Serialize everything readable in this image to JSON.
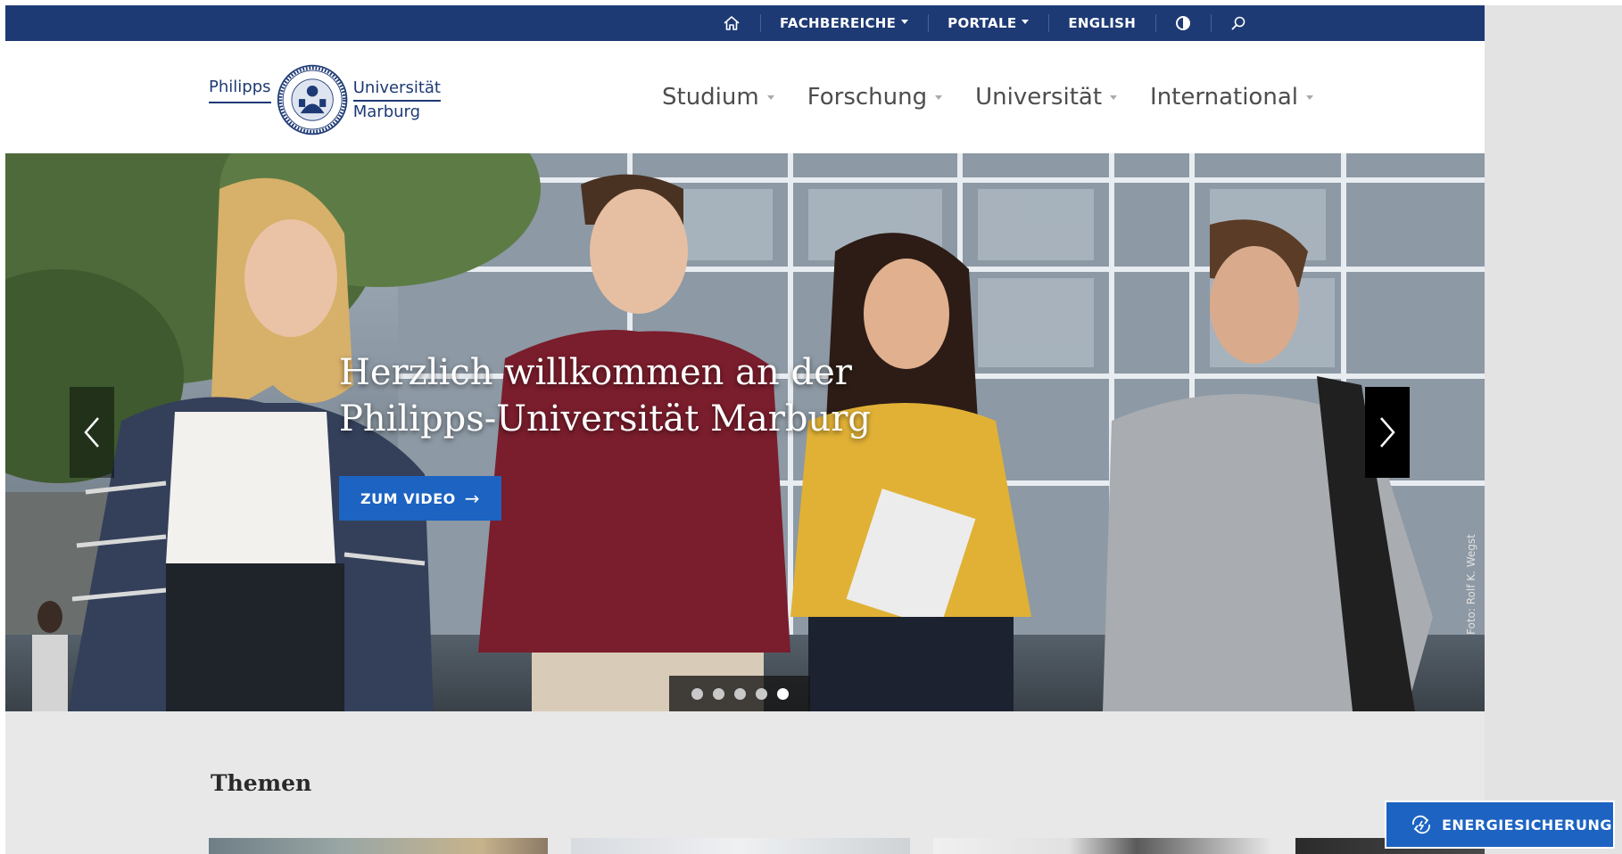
{
  "topbar": {
    "items": [
      {
        "label": "",
        "icon": "home-icon"
      },
      {
        "label": "FACHBEREICHE",
        "dropdown": true
      },
      {
        "label": "PORTALE",
        "dropdown": true
      },
      {
        "label": "ENGLISH"
      },
      {
        "label": "",
        "icon": "contrast-icon"
      },
      {
        "label": "",
        "icon": "search-icon"
      }
    ],
    "bg_color": "#1e3a75"
  },
  "logo": {
    "left_text": "Philipps",
    "right_line1": "Universität",
    "right_line2": "Marburg",
    "color": "#1e3a75"
  },
  "nav": {
    "items": [
      {
        "label": "Studium"
      },
      {
        "label": "Forschung"
      },
      {
        "label": "Universität"
      },
      {
        "label": "International"
      }
    ]
  },
  "hero": {
    "title": "Herzlich willkommen an der Philipps-Universität Marburg",
    "button_label": "ZUM VIDEO",
    "photo_credit": "Foto: Rolf K. Wegst",
    "slide_count": 5,
    "active_slide": 5,
    "button_color": "#1c63c2"
  },
  "themen": {
    "title": "Themen"
  },
  "energy": {
    "label": "ENERGIESICHERUNG"
  }
}
